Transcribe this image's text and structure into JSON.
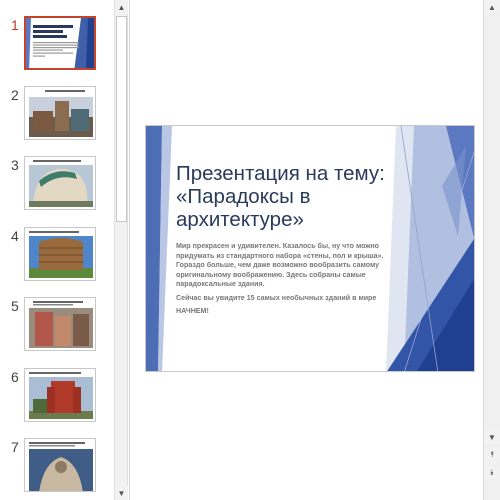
{
  "thumbnails": [
    {
      "number": "1",
      "title": "Презентация на тему: «Парадоксы в архитектуре»",
      "selected": true
    },
    {
      "number": "2",
      "title": "Деревянный музыкальный дом",
      "selected": false
    },
    {
      "number": "3",
      "title": "Кривой домик в Сопоте, Польша",
      "selected": false
    },
    {
      "number": "4",
      "title": "Здание корзины, Штат Огайо",
      "selected": false
    },
    {
      "number": "5",
      "title": "Необычный жилой дом",
      "selected": false
    },
    {
      "number": "6",
      "title": "Дом-крепость",
      "selected": false
    },
    {
      "number": "7",
      "title": "Здание с необычным фасадом",
      "selected": false
    }
  ],
  "slide": {
    "title_lines": [
      "Презентация на тему:",
      "«Парадоксы в",
      "архитектуре»"
    ],
    "body_1": "Мир прекрасен и удивителен. Казалось бы, ну что можно придумать из стандартного набора «стены, пол и крыша». Гораздо больше, чем даже возможно вообразить самому оригинальному воображению. Здесь собраны самые парадоксальные здания.",
    "body_2": "Сейчас вы увидите 15 самых необычных зданий в мире",
    "body_3": "НАЧНЕМ!"
  },
  "scrollbars": {
    "up_icon": "▲",
    "down_icon": "▼",
    "prev_slide_icon": "⯭",
    "next_slide_icon": "⯯"
  },
  "colors": {
    "accent": "#c5432b",
    "title_text": "#2a3a5c",
    "slide_blue": "#3f5fa8"
  }
}
